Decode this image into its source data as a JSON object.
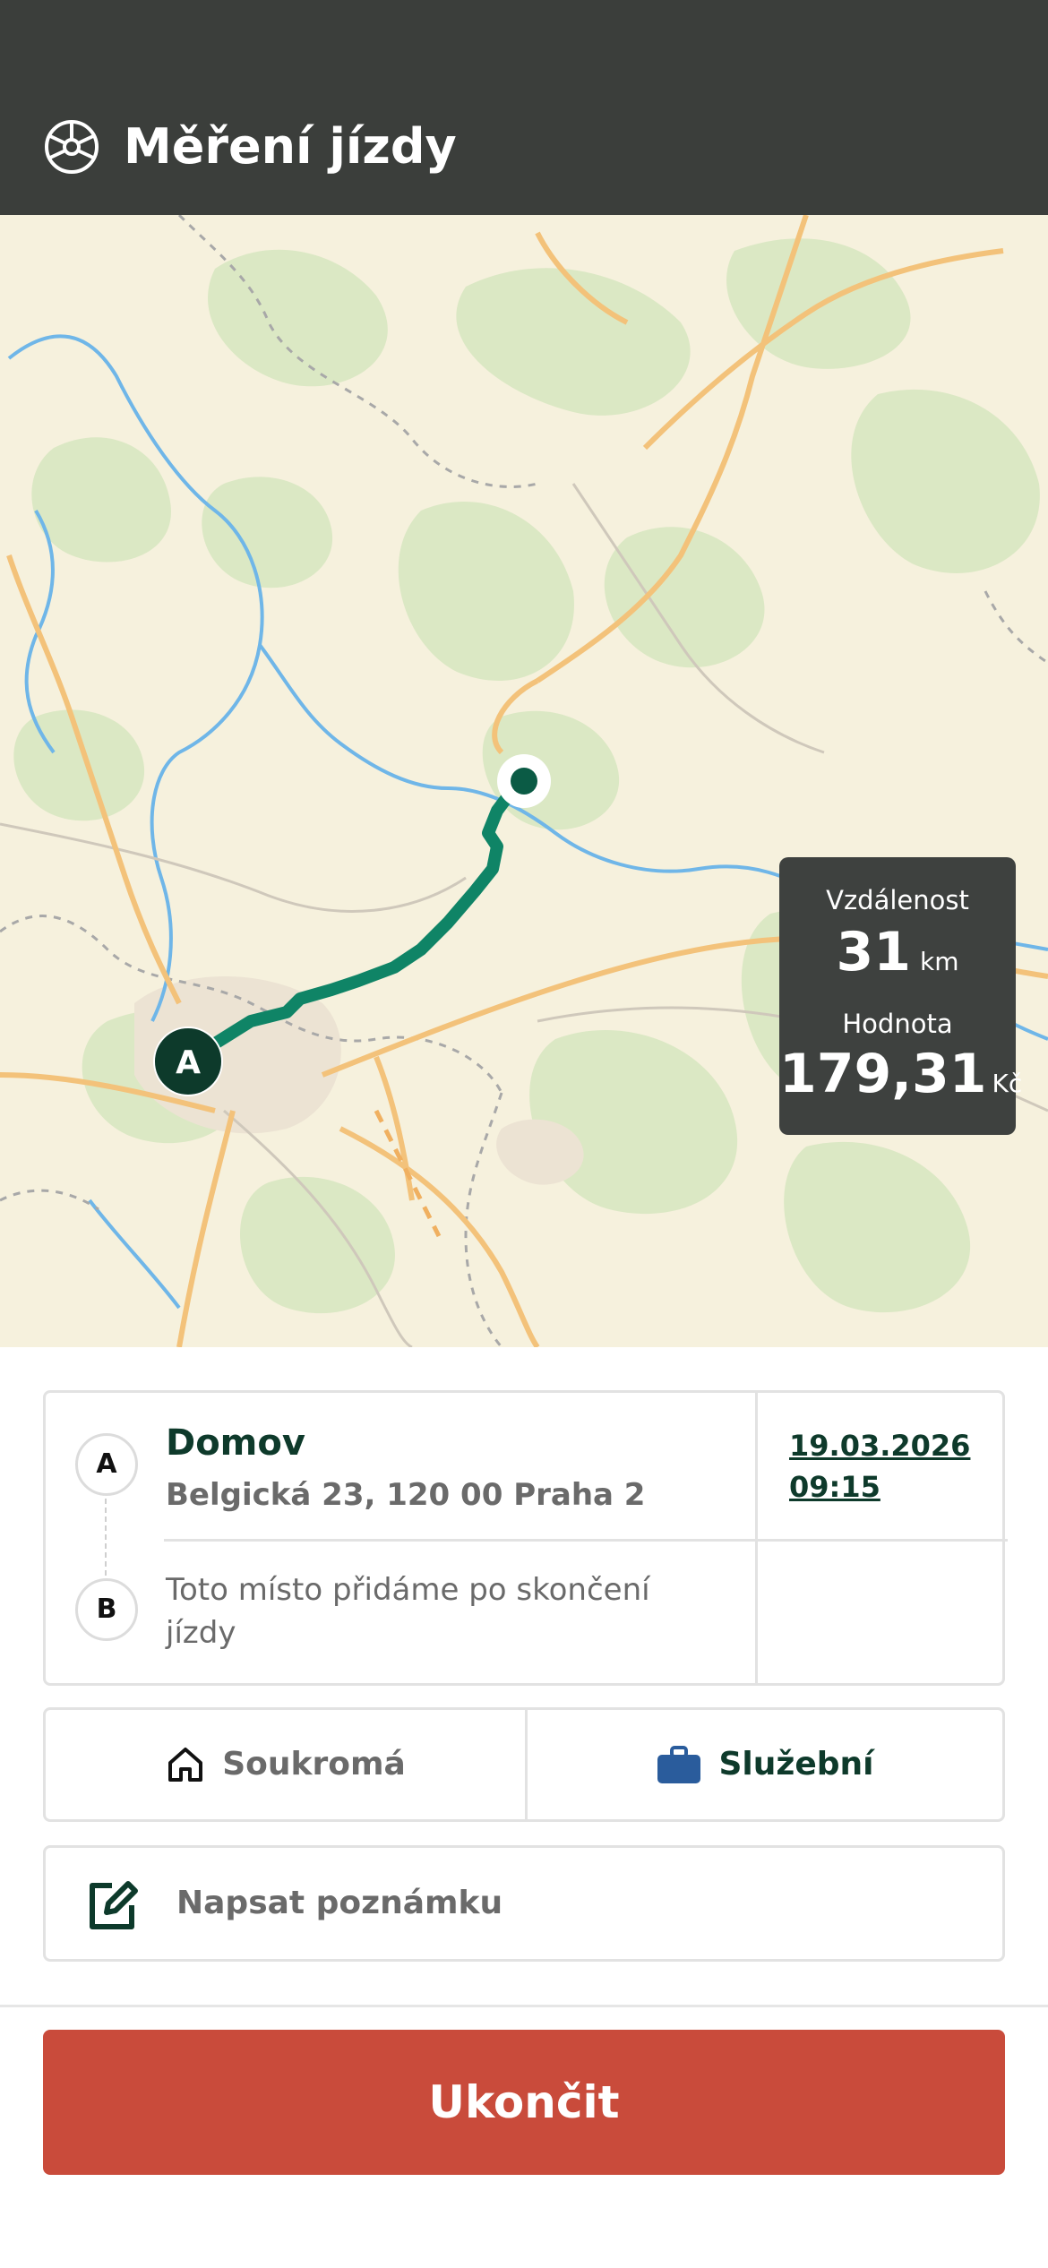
{
  "header": {
    "title": "Měření jízdy",
    "icon": "steering-wheel-icon"
  },
  "map": {
    "start_marker_label": "A",
    "stats": {
      "distance_label": "Vzdálenost",
      "distance_value": "31",
      "distance_unit": "km",
      "value_label": "Hodnota",
      "value_amount": "179,31",
      "value_unit": "Kč"
    },
    "route_color": "#0f8466"
  },
  "trip": {
    "start": {
      "marker": "A",
      "name": "Domov",
      "address": "Belgická 23, 120 00 Praha 2",
      "date": "19.03.2026",
      "time": "09:15"
    },
    "end": {
      "marker": "B",
      "placeholder": "Toto místo přidáme po skončení jízdy"
    }
  },
  "trip_type": {
    "private_label": "Soukromá",
    "private_icon": "home-icon",
    "business_label": "Služební",
    "business_icon": "briefcase-icon",
    "selected": "business"
  },
  "note": {
    "label": "Napsat poznámku",
    "icon": "edit-note-icon"
  },
  "actions": {
    "end_label": "Ukončit"
  },
  "colors": {
    "header_bg": "#3b3e3b",
    "accent_dark_green": "#0e3a2b",
    "route_green": "#0f8466",
    "end_button": "#c94b3b",
    "briefcase_blue": "#2a5c9c"
  }
}
